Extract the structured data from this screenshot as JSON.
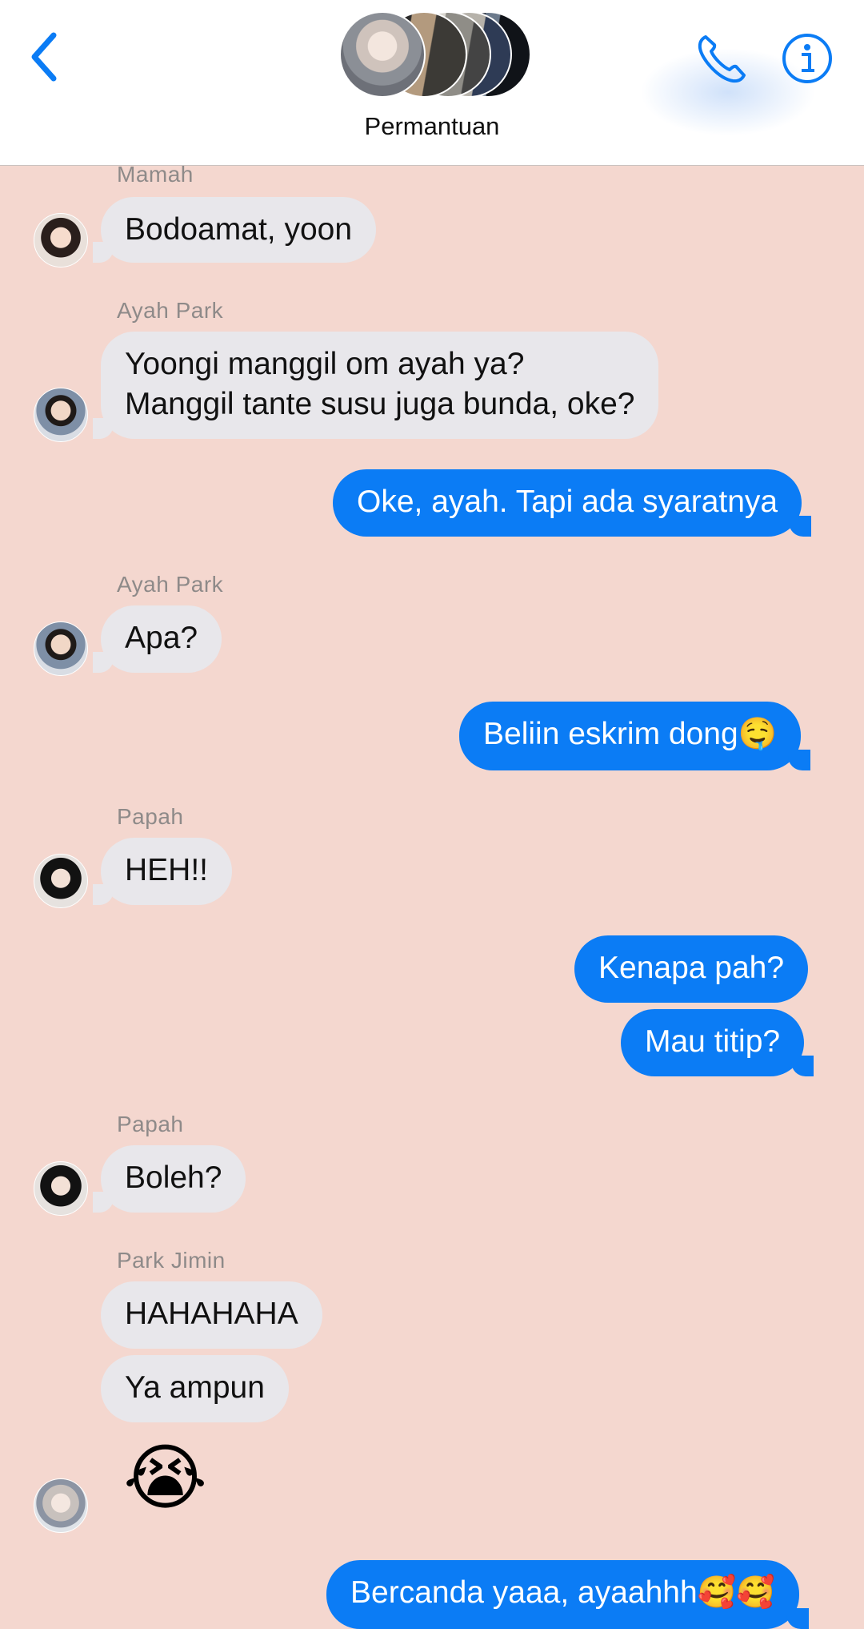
{
  "header": {
    "title": "Permantuan",
    "back_icon": "chevron-left-icon",
    "call_icon": "phone-icon",
    "info_icon": "info-icon",
    "accent": "#0b7cf5"
  },
  "messages": [
    {
      "sender": "Mamah",
      "text": "Bodoamat, yoon"
    },
    {
      "sender": "Ayah Park",
      "line1": "Yoongi manggil om ayah ya?",
      "line2": "Manggil tante susu juga bunda, oke?"
    },
    {
      "outgoing": "Oke, ayah. Tapi ada syaratnya"
    },
    {
      "sender": "Ayah Park",
      "text": "Apa?"
    },
    {
      "outgoing": "Beliin eskrim dong🤤"
    },
    {
      "sender": "Papah",
      "text": "HEH!!"
    },
    {
      "outgoing": "Kenapa pah?"
    },
    {
      "outgoing": "Mau titip?"
    },
    {
      "sender": "Papah",
      "text": "Boleh?"
    },
    {
      "sender": "Park Jimin",
      "text": "HAHAHAHA"
    },
    {
      "text": "Ya ampun"
    },
    {
      "emoji": "😭"
    },
    {
      "outgoing": "Bercanda yaaa, ayaahhh🥰🥰"
    }
  ]
}
